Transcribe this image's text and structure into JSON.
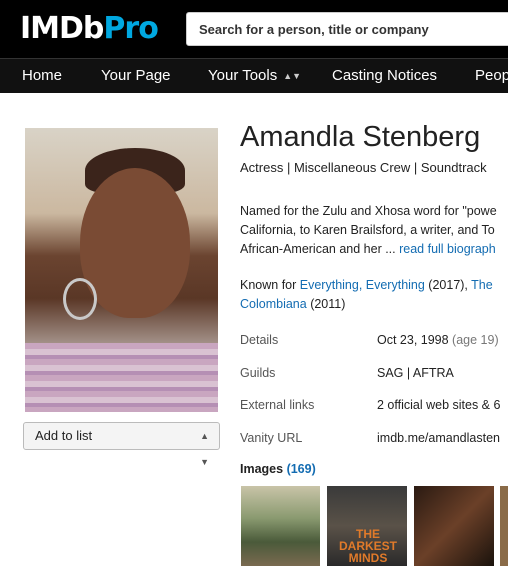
{
  "logo": {
    "part1": "IMDb",
    "part2": "Pro"
  },
  "search": {
    "placeholder": "Search for a person, title or company"
  },
  "nav": {
    "home": "Home",
    "your_page": "Your Page",
    "your_tools": "Your Tools",
    "casting": "Casting Notices",
    "people": "Peop"
  },
  "profile": {
    "name": "Amandla Stenberg",
    "roles": "Actress | Miscellaneous Crew | Soundtrack",
    "bio_line1": "Named for the Zulu and Xhosa word for \"powe",
    "bio_line2": "California, to Karen Brailsford, a writer, and To",
    "bio_line3_a": "African-American and her ... ",
    "bio_line3_link": "read full biograph",
    "known_label": "Known for ",
    "known_1": "Everything, Everything",
    "known_1_year": " (2017), ",
    "known_2": "The",
    "known_3": "Colombiana",
    "known_3_year": " (2011)",
    "add_list": "Add to list"
  },
  "details": {
    "label": "Details",
    "value": "Oct 23, 1998",
    "age": " (age 19)"
  },
  "guilds": {
    "label": "Guilds",
    "value": "SAG | AFTRA"
  },
  "external": {
    "label": "External links",
    "value": "2 official web sites & 6"
  },
  "vanity": {
    "label": "Vanity URL",
    "value": "imdb.me/amandlasten"
  },
  "images": {
    "label": "Images ",
    "count": "(169)",
    "thumb2_title": "THE DARKEST MINDS"
  },
  "colors": {
    "accent": "#00a8e1",
    "link": "#136cb2",
    "nav_bg": "#111111"
  }
}
